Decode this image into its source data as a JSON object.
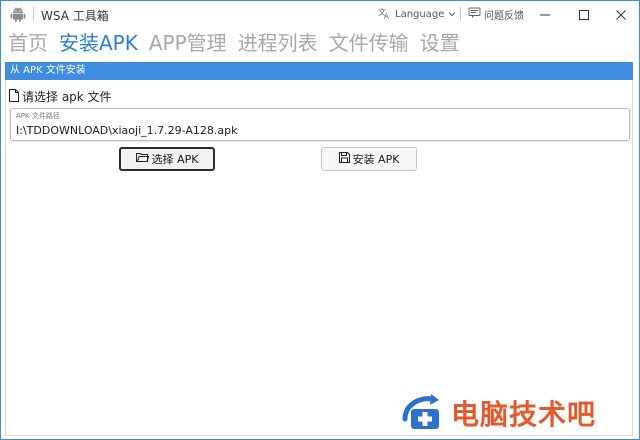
{
  "titlebar": {
    "title": "WSA 工具箱",
    "language_label": "Language",
    "feedback_label": "问题反馈"
  },
  "nav": {
    "items": [
      {
        "label": "首页",
        "active": false
      },
      {
        "label": "安装APK",
        "active": true
      },
      {
        "label": "APP管理",
        "active": false
      },
      {
        "label": "进程列表",
        "active": false
      },
      {
        "label": "文件传输",
        "active": false
      },
      {
        "label": "设置",
        "active": false
      }
    ]
  },
  "section": {
    "header": "从 APK 文件安装",
    "choose_label": "请选择 apk 文件",
    "path_label": "APK 文件路径",
    "path_value": "I:\\TDDOWNLOAD\\xiaoji_1.7.29-A128.apk",
    "select_button": "选择 APK",
    "install_button": "安装 APK"
  },
  "watermark": {
    "text": "电脑技术吧"
  },
  "colors": {
    "accent": "#3f8de0",
    "nav_active": "#2a7fd4",
    "nav_inactive": "#a8a8a8",
    "watermark": "#e8572a"
  },
  "icons": {
    "app": "android-icon",
    "language": "translate-icon",
    "feedback": "feedback-icon",
    "file": "file-icon",
    "folder": "folder-open-icon",
    "save": "save-icon"
  }
}
